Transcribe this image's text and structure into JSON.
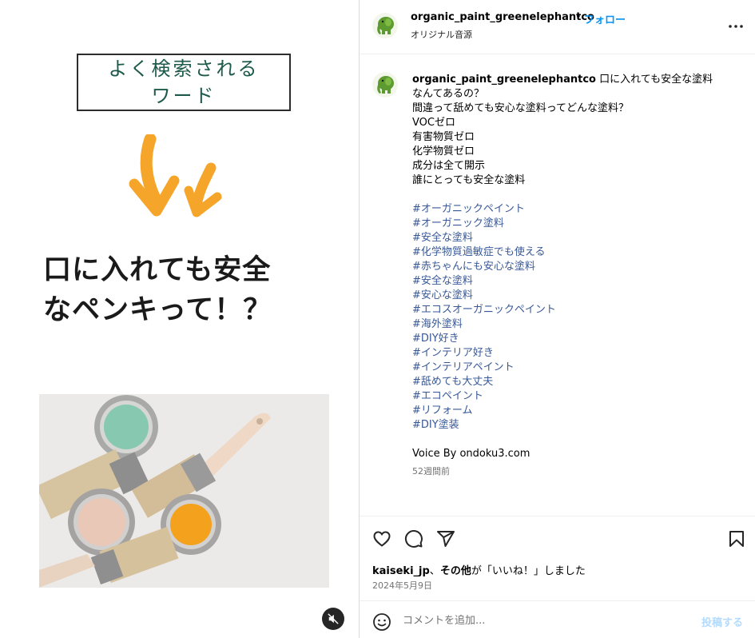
{
  "media": {
    "keyword_lines": [
      "よく検索される",
      "ワード"
    ],
    "headline_lines": [
      "口に入れても安全",
      "なペンキって！？"
    ]
  },
  "header": {
    "username": "organic_paint_greenelephantco",
    "separator": "•",
    "follow_label": "フォロー",
    "audio": "オリジナル音源"
  },
  "caption": {
    "username": "organic_paint_greenelephantco",
    "first_line": "口に入れても安全な塗料",
    "lines": [
      "なんてあるの？",
      "間違って舐めても安心な塗料ってどんな塗料？",
      "VOCゼロ",
      "有害物質ゼロ",
      "化学物質ゼロ",
      "成分は全て開示",
      "誰にとっても安全な塗料"
    ],
    "hashtags": [
      "#オーガニックペイント",
      "#オーガニック塗料",
      "#安全な塗料",
      "#化学物質過敏症でも使える",
      "#赤ちゃんにも安心な塗料",
      "#安全な塗料",
      "#安心な塗料",
      "#エコスオーガニックペイント",
      "#海外塗料",
      "#DIY好き",
      "#インテリア好き",
      "#インテリアペイント",
      "#舐めても大丈夫",
      "#エコペイント",
      "#リフォーム",
      "#DIY塗装"
    ],
    "voice_credit": "Voice By ondoku3.com",
    "time_ago": "52週間前"
  },
  "likes": {
    "user": "kaiseki_jp",
    "sep": "、",
    "others": "その他",
    "suffix": "が「いいね！」しました"
  },
  "date": "2024年5月9日",
  "composer": {
    "placeholder": "コメントを追加...",
    "post_label": "投稿する"
  },
  "icons": {
    "like": "heart-icon",
    "comment": "comment-icon",
    "share": "share-icon",
    "save": "bookmark-icon",
    "more": "more-icon",
    "emoji": "emoji-icon",
    "mute": "muted-speaker-icon"
  },
  "colors": {
    "follow": "#0095f6",
    "hashtag": "#385898",
    "keyword_text": "#1e5a4b",
    "arrow": "#f5a52a",
    "post_disabled": "#b3dbff"
  }
}
